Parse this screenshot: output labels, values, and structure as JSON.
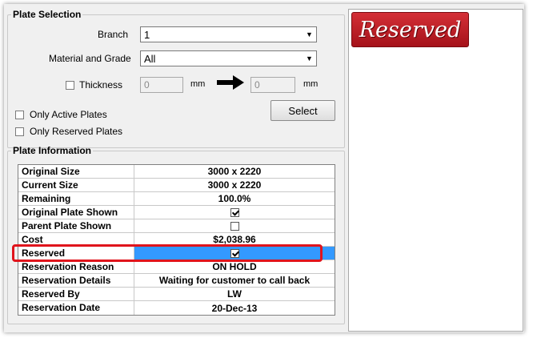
{
  "selection": {
    "title": "Plate Selection",
    "branch_label": "Branch",
    "branch_value": "1",
    "material_label": "Material and Grade",
    "material_value": "All",
    "thickness_label": "Thickness",
    "thickness_from": "0",
    "thickness_to": "0",
    "unit": "mm",
    "only_active_label": "Only Active Plates",
    "only_reserved_label": "Only Reserved Plates",
    "select_label": "Select"
  },
  "info": {
    "title": "Plate Information",
    "rows": [
      {
        "key": "Original Size",
        "value": "3000 x 2220"
      },
      {
        "key": "Current Size",
        "value": "3000 x 2220"
      },
      {
        "key": "Remaining",
        "value": "100.0%"
      },
      {
        "key": "Original Plate Shown",
        "checked": true
      },
      {
        "key": "Parent Plate Shown",
        "checked": false
      },
      {
        "key": "Cost",
        "value": "$2,038.96"
      },
      {
        "key": "Reserved",
        "checked": true
      },
      {
        "key": "Reservation Reason",
        "value": "ON HOLD"
      },
      {
        "key": "Reservation Details",
        "value": "Waiting for customer to call back"
      },
      {
        "key": "Reserved By",
        "value": "LW"
      },
      {
        "key": "Reservation Date",
        "value": "20-Dec-13"
      }
    ]
  },
  "stamp": {
    "text": "Reserved"
  },
  "colors": {
    "selected_row": "#3399ff",
    "highlight": "#e0141c",
    "stamp": "#c1222a"
  }
}
